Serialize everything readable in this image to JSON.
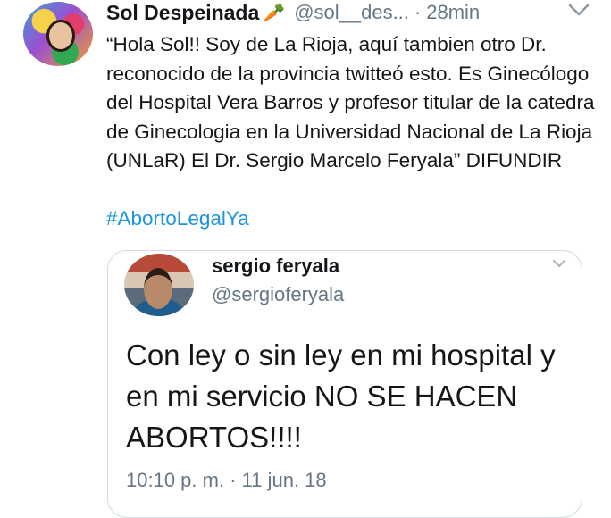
{
  "tweet": {
    "author_name": "Sol Despeinada",
    "author_emoji": "🥕",
    "handle": "@sol__des...",
    "separator": "·",
    "time": "28min",
    "text": "“Hola Sol!! Soy de La Rioja, aquí tambien otro Dr. reconocido de la provincia twitteó esto. Es Ginecólogo del Hospital Vera Barros y profesor titular de la catedra de Ginecologia en la Universidad Nacional de La Rioja (UNLaR) El Dr. Sergio Marcelo Feryala” DIFUNDIR",
    "hashtag": "#AbortoLegalYa"
  },
  "quoted_tweet": {
    "author_name": "sergio feryala",
    "handle": "@sergioferyala",
    "text": "Con ley o sin ley en mi hospital y en mi servicio NO SE HACEN ABORTOS!!!!",
    "timestamp": "10:10 p. m. · 11 jun. 18"
  },
  "icons": {
    "menu": "chevron-down-icon",
    "quote_menu": "chevron-down-icon"
  },
  "colors": {
    "link": "#1b95e0",
    "secondary_text": "#657786",
    "primary_text": "#14171a",
    "card_border": "#cfd9de"
  }
}
